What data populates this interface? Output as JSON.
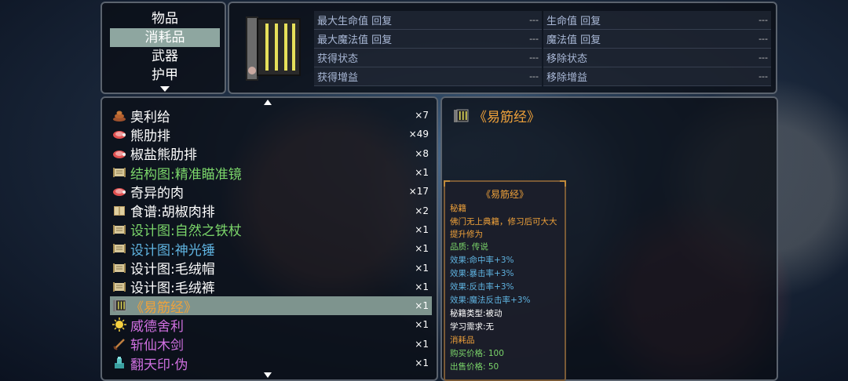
{
  "categories": {
    "items": [
      "物品",
      "消耗品",
      "武器",
      "护甲"
    ],
    "selected_index": 1
  },
  "summary": {
    "rows": [
      [
        {
          "label": "最大生命值 回复",
          "value": "---"
        },
        {
          "label": "生命值 回复",
          "value": "---"
        }
      ],
      [
        {
          "label": "最大魔法值 回复",
          "value": "---"
        },
        {
          "label": "魔法值 回复",
          "value": "---"
        }
      ],
      [
        {
          "label": "获得状态",
          "value": "---"
        },
        {
          "label": "移除状态",
          "value": "---"
        }
      ],
      [
        {
          "label": "获得增益",
          "value": "---"
        },
        {
          "label": "移除增益",
          "value": "---"
        }
      ]
    ]
  },
  "items": [
    {
      "name": "奥利给",
      "qty": "×7",
      "color": "#ffffff",
      "icon": "poop-icon"
    },
    {
      "name": "熊肋排",
      "qty": "×49",
      "color": "#ffffff",
      "icon": "meat-icon"
    },
    {
      "name": "椒盐熊肋排",
      "qty": "×8",
      "color": "#ffffff",
      "icon": "meat-icon"
    },
    {
      "name": "结构图:精准瞄准镜",
      "qty": "×1",
      "color": "#7bd66a",
      "icon": "scroll-icon"
    },
    {
      "name": "奇异的肉",
      "qty": "×17",
      "color": "#ffffff",
      "icon": "meat-icon"
    },
    {
      "name": "食谱:胡椒肉排",
      "qty": "×2",
      "color": "#ffffff",
      "icon": "book-icon"
    },
    {
      "name": "设计图:自然之铁杖",
      "qty": "×1",
      "color": "#7bd66a",
      "icon": "scroll-icon"
    },
    {
      "name": "设计图:神光锤",
      "qty": "×1",
      "color": "#5fb3e0",
      "icon": "scroll-icon"
    },
    {
      "name": "设计图:毛绒帽",
      "qty": "×1",
      "color": "#ffffff",
      "icon": "scroll-icon"
    },
    {
      "name": "设计图:毛绒裤",
      "qty": "×1",
      "color": "#ffffff",
      "icon": "scroll-icon"
    },
    {
      "name": "《易筋经》",
      "qty": "×1",
      "color": "#f0a23a",
      "icon": "manual-icon"
    },
    {
      "name": "威德舍利",
      "qty": "×1",
      "color": "#d070e0",
      "icon": "relic-icon"
    },
    {
      "name": "斩仙木剑",
      "qty": "×1",
      "color": "#d070e0",
      "icon": "sword-icon"
    },
    {
      "name": "翻天印·伪",
      "qty": "×1",
      "color": "#d070e0",
      "icon": "seal-icon"
    }
  ],
  "selected_item_index": 10,
  "detail": {
    "title": "《易筋经》"
  },
  "tooltip": {
    "title": "《易筋经》",
    "type": "秘籍",
    "desc": "佛门无上典籍，修习后可大大提升修为",
    "quality": "品质: 传说",
    "effects": [
      "效果:命中率+3%",
      "效果:暴击率+3%",
      "效果:反击率+3%",
      "效果:魔法反击率+3%"
    ],
    "skill_type": "秘籍类型:被动",
    "requirement": "学习需求:无",
    "category": "消耗品",
    "buy_price": "购买价格: 100",
    "sell_price": "出售价格: 50"
  },
  "colors": {
    "legendary": "#f0a23a",
    "rare_green": "#7bd66a",
    "rare_blue": "#5fb3e0",
    "epic_purple": "#d070e0",
    "panel_border": "#5b636e",
    "selected_row": "#7e948e"
  }
}
